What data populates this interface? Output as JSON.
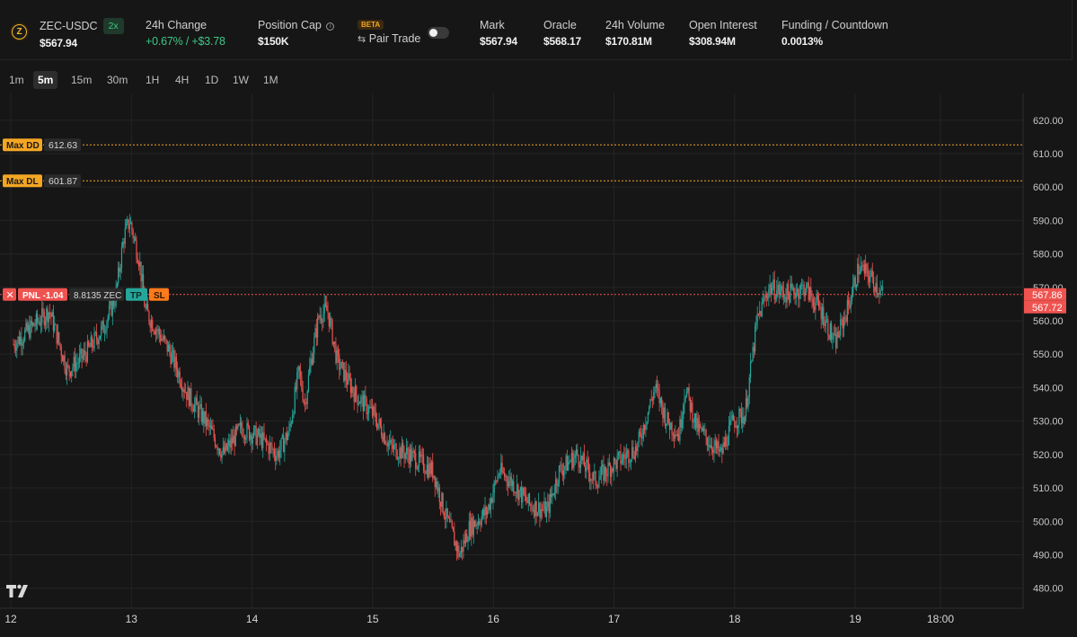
{
  "header": {
    "symbol": "ZEC-USDC",
    "leverage": "2x",
    "price": "$567.94",
    "change_label": "24h Change",
    "change_pct": "+0.67%",
    "change_sep": " / ",
    "change_abs": "+$3.78",
    "position_cap_label": "Position Cap",
    "position_cap_value": "$150K",
    "beta_label": "BETA",
    "pair_trade_label": "Pair Trade",
    "pair_trade_enabled": false,
    "mark_label": "Mark",
    "mark_value": "$567.94",
    "oracle_label": "Oracle",
    "oracle_value": "$568.17",
    "volume_label": "24h Volume",
    "volume_value": "$170.81M",
    "oi_label": "Open Interest",
    "oi_value": "$308.94M",
    "funding_label": "Funding / Countdown",
    "funding_value": "0.0013%"
  },
  "timeframes": {
    "items": [
      "1m",
      "5m",
      "15m",
      "30m",
      "1H",
      "4H",
      "1D",
      "1W",
      "1M"
    ],
    "selected": "5m"
  },
  "chart_data": {
    "type": "candlestick",
    "symbol": "ZEC-USDC",
    "interval": "5m",
    "ylim": [
      474,
      628
    ],
    "y_ticks": [
      480,
      490,
      500,
      510,
      520,
      530,
      540,
      550,
      560,
      570,
      580,
      590,
      600,
      610,
      620
    ],
    "x_ticks": [
      "12",
      "13",
      "14",
      "15",
      "16",
      "17",
      "18",
      "19",
      "18:00"
    ],
    "last_price": 567.86,
    "price_tags": [
      "567.86",
      "567.72"
    ],
    "price_path": [
      [
        0,
        553
      ],
      [
        0.15,
        558
      ],
      [
        0.3,
        563
      ],
      [
        0.45,
        545
      ],
      [
        0.6,
        550
      ],
      [
        0.75,
        558
      ],
      [
        0.85,
        567
      ],
      [
        0.92,
        585
      ],
      [
        0.97,
        590
      ],
      [
        1.05,
        578
      ],
      [
        1.1,
        563
      ],
      [
        1.2,
        557
      ],
      [
        1.3,
        551
      ],
      [
        1.45,
        538
      ],
      [
        1.6,
        530
      ],
      [
        1.75,
        520
      ],
      [
        1.9,
        528
      ],
      [
        2.05,
        525
      ],
      [
        2.2,
        520
      ],
      [
        2.3,
        527
      ],
      [
        2.38,
        545
      ],
      [
        2.43,
        535
      ],
      [
        2.48,
        548
      ],
      [
        2.55,
        562
      ],
      [
        2.62,
        563
      ],
      [
        2.7,
        548
      ],
      [
        2.85,
        538
      ],
      [
        3.0,
        532
      ],
      [
        3.15,
        522
      ],
      [
        3.3,
        520
      ],
      [
        3.5,
        515
      ],
      [
        3.6,
        502
      ],
      [
        3.72,
        490
      ],
      [
        3.8,
        498
      ],
      [
        3.95,
        503
      ],
      [
        4.05,
        515
      ],
      [
        4.15,
        512
      ],
      [
        4.3,
        505
      ],
      [
        4.45,
        503
      ],
      [
        4.55,
        515
      ],
      [
        4.7,
        520
      ],
      [
        4.85,
        512
      ],
      [
        5.0,
        517
      ],
      [
        5.2,
        522
      ],
      [
        5.35,
        540
      ],
      [
        5.45,
        530
      ],
      [
        5.55,
        526
      ],
      [
        5.6,
        540
      ],
      [
        5.7,
        528
      ],
      [
        5.8,
        524
      ],
      [
        5.9,
        520
      ],
      [
        6.0,
        530
      ],
      [
        6.1,
        532
      ],
      [
        6.2,
        560
      ],
      [
        6.3,
        570
      ],
      [
        6.45,
        568
      ],
      [
        6.6,
        570
      ],
      [
        6.75,
        562
      ],
      [
        6.85,
        553
      ],
      [
        6.95,
        563
      ],
      [
        7.05,
        576
      ],
      [
        7.15,
        573
      ],
      [
        7.25,
        567.9
      ]
    ],
    "annotations": [
      {
        "label": "Max DD",
        "value": 612.63,
        "value_text": "612.63",
        "color": "#f4a623"
      },
      {
        "label": "Max DL",
        "value": 601.87,
        "value_text": "601.87",
        "color": "#f4a623"
      }
    ],
    "position": {
      "pnl_label": "PNL -1.04",
      "size_label": "8.8135 ZEC",
      "tp_label": "TP",
      "sl_label": "SL",
      "entry_price": 567.86
    },
    "colors": {
      "up": "#26a69a",
      "down": "#ef5350",
      "position_line": "#ef5350",
      "annotation_line": "#f4a623",
      "tp": "#26a69a",
      "sl": "#ff7a1a"
    }
  }
}
